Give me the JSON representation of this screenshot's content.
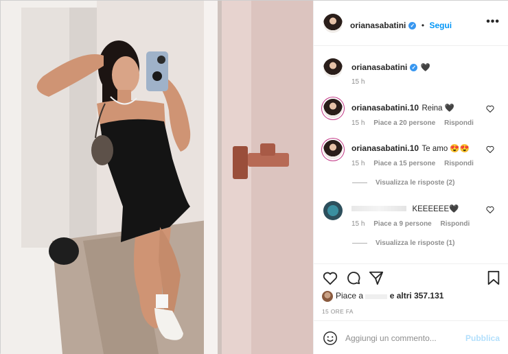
{
  "post": {
    "author": "orianasabatini",
    "follow_label": "Segui",
    "more_icon": "more-horizontal-icon"
  },
  "caption": {
    "author": "orianasabatini",
    "text": "🖤",
    "time": "15 h"
  },
  "comments": [
    {
      "author": "orianasabatini.10",
      "text": "Reina 🖤",
      "time": "15 h",
      "likes": "Piace a 20 persone",
      "reply": "Rispondi"
    },
    {
      "author": "orianasabatini.10",
      "text": "Te amo 😍😍",
      "time": "15 h",
      "likes": "Piace a 15 persone",
      "reply": "Rispondi",
      "replies": "Visualizza le risposte (2)"
    },
    {
      "author": "",
      "text": "KEEEEEE🖤",
      "time": "15 h",
      "likes": "Piace a 9 persone",
      "reply": "Rispondi",
      "replies": "Visualizza le risposte (1)"
    }
  ],
  "likes": {
    "prefix": "Piace a",
    "suffix": "e altri 357.131"
  },
  "time_ago": "15 ORE FA",
  "add_comment": {
    "placeholder": "Aggiungi un commento...",
    "publish": "Pubblica"
  },
  "colors": {
    "accent": "#0095f6",
    "verified": "#3897f0",
    "muted": "#8e8e8e"
  }
}
